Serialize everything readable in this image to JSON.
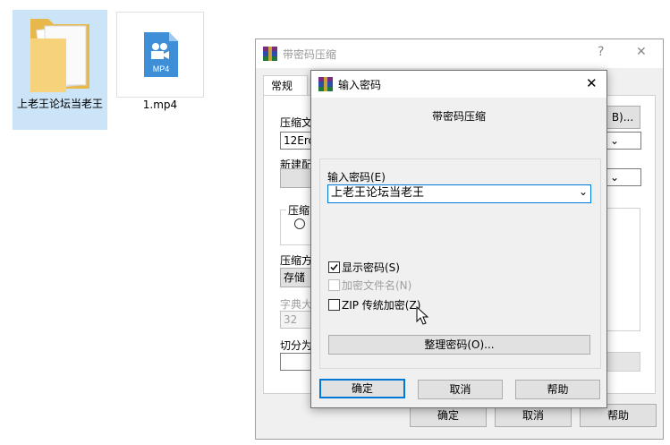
{
  "desktop": {
    "folder_label": "上老王论坛当老王",
    "file_label": "1.mp4",
    "file_icon_text": "MP4"
  },
  "bg_window": {
    "title": "带密码压缩",
    "help_glyph": "?",
    "close_glyph": "✕",
    "tab_general": "常规",
    "archive_label": "压缩文",
    "archive_value": "12Erov",
    "browse_label": "B)...",
    "config_label": "新建配",
    "format_label": "压缩",
    "method_label": "压缩方",
    "method_value": "存储",
    "dict_label": "字典大",
    "dict_value": "32",
    "split_label": "切分为",
    "ok": "确定",
    "cancel": "取消",
    "help": "帮助"
  },
  "dialog": {
    "title": "输入密码",
    "close_glyph": "✕",
    "heading": "带密码压缩",
    "password_label": "输入密码(E)",
    "password_value": "上老王论坛当老王",
    "show_password": "显示密码(S)",
    "show_password_checked": true,
    "encrypt_names": "加密文件名(N)",
    "zip_legacy": "ZIP 传统加密(Z)",
    "organize": "整理密码(O)...",
    "ok": "确定",
    "cancel": "取消",
    "help": "帮助"
  }
}
